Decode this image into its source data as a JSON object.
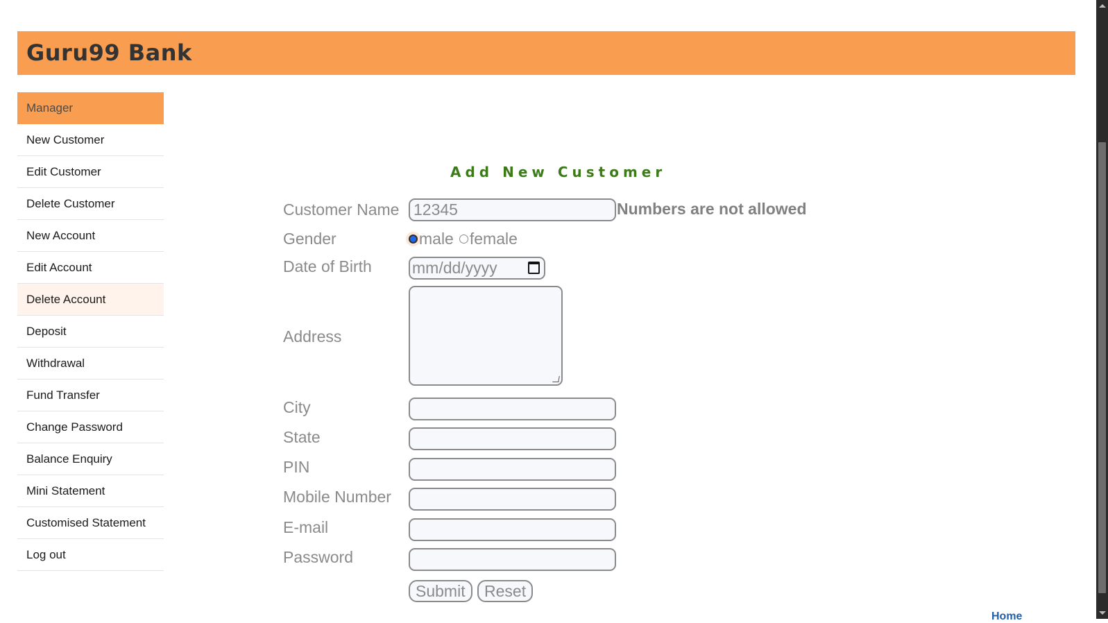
{
  "header": {
    "brand": "Guru99 Bank"
  },
  "sidebar": {
    "items": [
      {
        "label": "Manager"
      },
      {
        "label": "New Customer"
      },
      {
        "label": "Edit Customer"
      },
      {
        "label": "Delete Customer"
      },
      {
        "label": "New Account"
      },
      {
        "label": "Edit Account"
      },
      {
        "label": "Delete Account"
      },
      {
        "label": "Deposit"
      },
      {
        "label": "Withdrawal"
      },
      {
        "label": "Fund Transfer"
      },
      {
        "label": "Change Password"
      },
      {
        "label": "Balance Enquiry"
      },
      {
        "label": "Mini Statement"
      },
      {
        "label": "Customised Statement"
      },
      {
        "label": "Log out"
      }
    ]
  },
  "form": {
    "title": "Add New Customer",
    "labels": {
      "customer_name": "Customer Name",
      "gender": "Gender",
      "dob": "Date of Birth",
      "address": "Address",
      "city": "City",
      "state": "State",
      "pin": "PIN",
      "mobile": "Mobile Number",
      "email": "E-mail",
      "password": "Password"
    },
    "customer_name_value": "12345",
    "error_message": "Numbers are not allowed",
    "gender_options": {
      "male": "male",
      "female": "female",
      "selected": "male"
    },
    "dob_placeholder": "mm/dd/yyyy",
    "submit_label": "Submit",
    "reset_label": "Reset"
  },
  "footer": {
    "home_link": "Home"
  },
  "colors": {
    "header": "#f99d50",
    "title": "#3d7a1a",
    "label": "#8a8a8a",
    "link": "#1f5fa8"
  }
}
